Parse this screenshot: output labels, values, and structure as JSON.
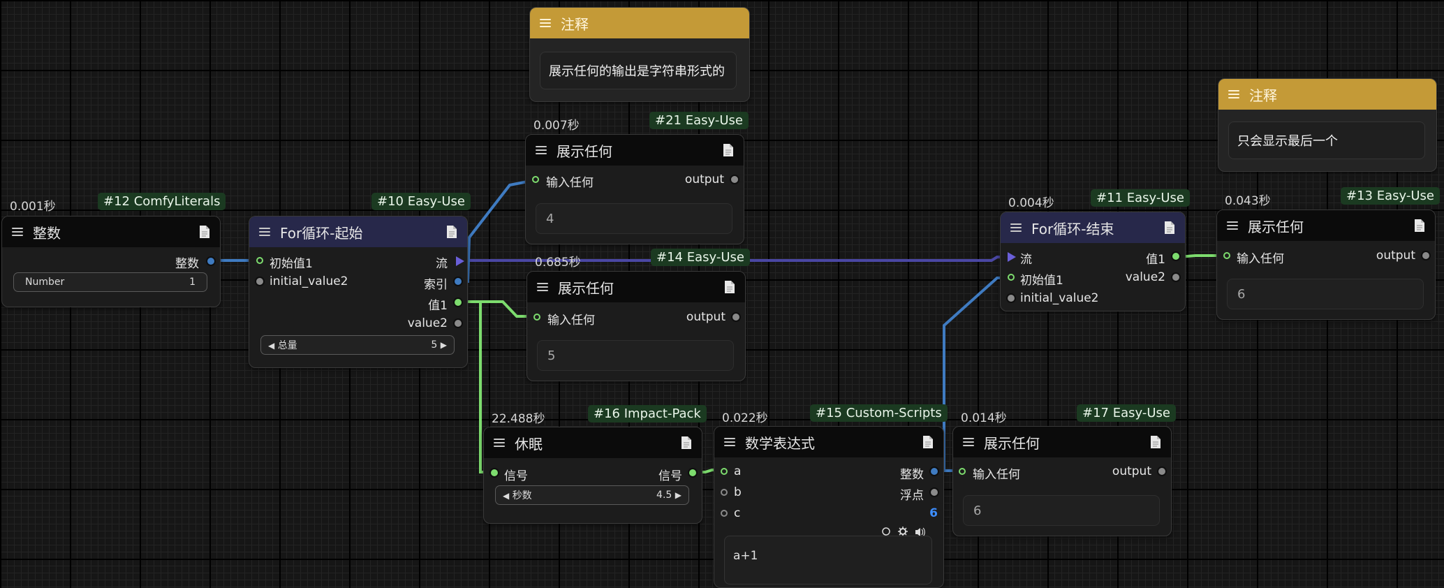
{
  "nodes": {
    "n12": {
      "time": "0.001秒",
      "tag": "#12 ComfyLiterals",
      "title": "整数",
      "output": "整数",
      "widget_label": "Number",
      "widget_value": "1"
    },
    "n10": {
      "tag": "#10 Easy-Use",
      "title": "For循环-起始",
      "in1": "初始值1",
      "in2": "initial_value2",
      "out1": "流",
      "out2": "索引",
      "out3": "值1",
      "out4": "value2",
      "widget_label": "总量",
      "widget_value": "5"
    },
    "note1": {
      "title": "注释",
      "text": "展示任何的输出是字符串形式的"
    },
    "n21": {
      "time": "0.007秒",
      "tag": "#21 Easy-Use",
      "title": "展示任何",
      "input": "输入任何",
      "output": "output",
      "value": "4"
    },
    "n14": {
      "time": "0.685秒",
      "tag": "#14 Easy-Use",
      "title": "展示任何",
      "input": "输入任何",
      "output": "output",
      "value": "5"
    },
    "n16": {
      "time": "22.488秒",
      "tag": "#16 Impact-Pack",
      "title": "休眠",
      "input": "信号",
      "output": "信号",
      "widget_label": "秒数",
      "widget_value": "4.5"
    },
    "n15": {
      "time": "0.022秒",
      "tag": "#15 Custom-Scripts",
      "title": "数学表达式",
      "in_a": "a",
      "in_b": "b",
      "in_c": "c",
      "out1": "整数",
      "out2": "浮点",
      "result": "6",
      "expression": "a+1"
    },
    "n17": {
      "time": "0.014秒",
      "tag": "#17 Easy-Use",
      "title": "展示任何",
      "input": "输入任何",
      "output": "output",
      "value": "6"
    },
    "n11": {
      "time": "0.004秒",
      "tag": "#11 Easy-Use",
      "title": "For循环-结束",
      "in1": "流",
      "in2": "初始值1",
      "in3": "initial_value2",
      "out1": "值1",
      "out2": "value2"
    },
    "note2": {
      "title": "注释",
      "text": "只会显示最后一个"
    },
    "n13": {
      "time": "0.043秒",
      "tag": "#13 Easy-Use",
      "title": "展示任何",
      "input": "输入任何",
      "output": "output",
      "value": "6"
    }
  },
  "colors": {
    "int_wire": "#3f7bc1",
    "flow_wire": "#4a47a3",
    "any_wire": "#7ddc6e",
    "note_header": "#c49a37",
    "tag_bg": "#1b3a21",
    "result_blue": "#3d8eff"
  },
  "icons": [
    "menu-icon",
    "document-icon",
    "flow-arrow-icon",
    "circle-icon",
    "gear-icon",
    "speaker-icon"
  ]
}
